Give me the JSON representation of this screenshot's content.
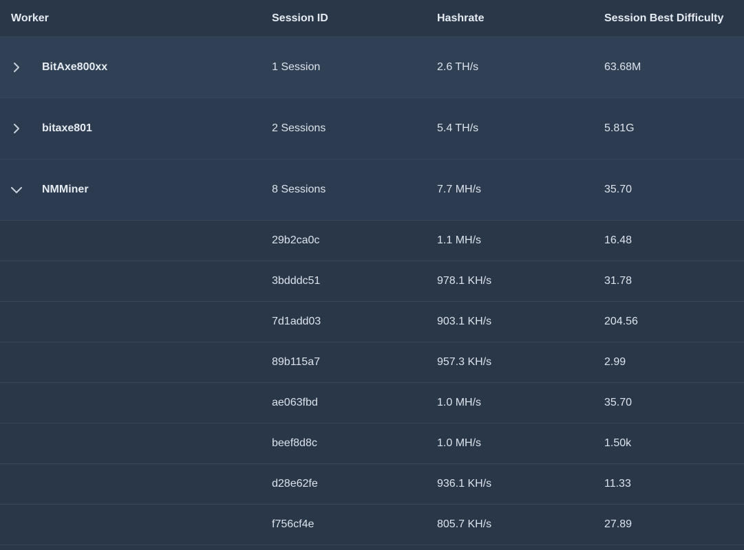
{
  "columns": {
    "worker": "Worker",
    "session_id": "Session ID",
    "hashrate": "Hashrate",
    "best_difficulty": "Session Best Difficulty"
  },
  "workers": [
    {
      "name": "BitAxe800xx",
      "sessions": "1 Session",
      "hashrate": "2.6 TH/s",
      "best": "63.68M",
      "expanded": false
    },
    {
      "name": "bitaxe801",
      "sessions": "2 Sessions",
      "hashrate": "5.4 TH/s",
      "best": "5.81G",
      "expanded": false
    },
    {
      "name": "NMMiner",
      "sessions": "8 Sessions",
      "hashrate": "7.7 MH/s",
      "best": "35.70",
      "expanded": true
    }
  ],
  "sessions": [
    {
      "id": "29b2ca0c",
      "hashrate": "1.1 MH/s",
      "best": "16.48"
    },
    {
      "id": "3bdddc51",
      "hashrate": "978.1 KH/s",
      "best": "31.78"
    },
    {
      "id": "7d1add03",
      "hashrate": "903.1 KH/s",
      "best": "204.56"
    },
    {
      "id": "89b115a7",
      "hashrate": "957.3 KH/s",
      "best": "2.99"
    },
    {
      "id": "ae063fbd",
      "hashrate": "1.0 MH/s",
      "best": "35.70"
    },
    {
      "id": "beef8d8c",
      "hashrate": "1.0 MH/s",
      "best": "1.50k"
    },
    {
      "id": "d28e62fe",
      "hashrate": "936.1 KH/s",
      "best": "11.33"
    },
    {
      "id": "f756cf4e",
      "hashrate": "805.7 KH/s",
      "best": "27.89"
    }
  ],
  "icons": {
    "collapsed": "chevron-right-icon",
    "expanded": "chevron-down-icon"
  },
  "colors": {
    "background": "#2a3749",
    "row": "#2c3b4f",
    "text": "#dde3ec",
    "divider": "#36455a"
  }
}
